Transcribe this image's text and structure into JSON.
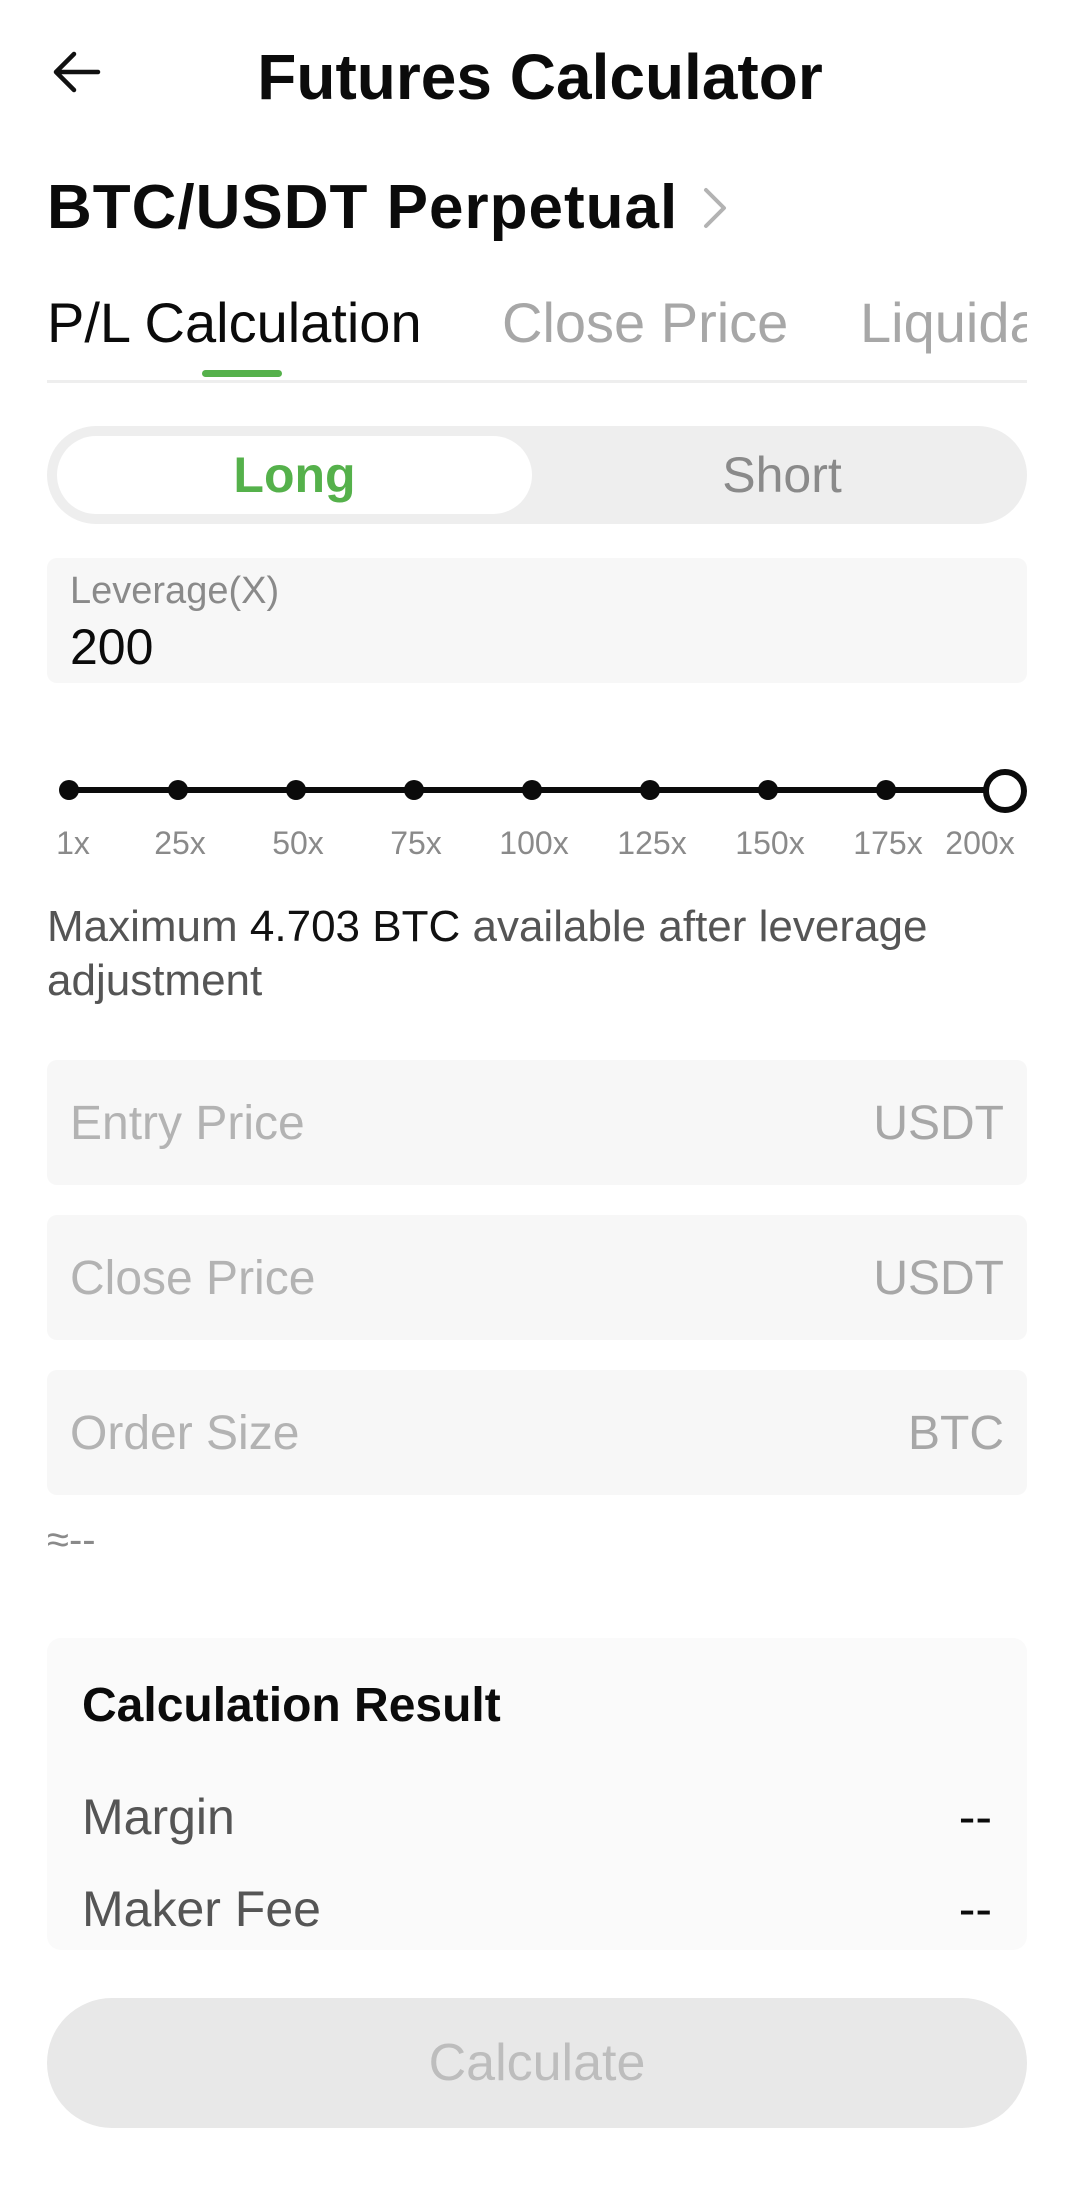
{
  "header": {
    "title": "Futures Calculator",
    "back_icon": "arrow-left-icon"
  },
  "pair": {
    "name": "BTC/USDT Perpetual",
    "chevron_icon": "chevron-right-icon"
  },
  "tabs": [
    {
      "label": "P/L Calculation",
      "active": true
    },
    {
      "label": "Close Price",
      "active": false
    },
    {
      "label": "Liquidati",
      "active": false
    }
  ],
  "direction": {
    "long_label": "Long",
    "short_label": "Short",
    "selected": "Long"
  },
  "leverage": {
    "label": "Leverage(X)",
    "value": "200",
    "slider_labels": [
      "1x",
      "25x",
      "50x",
      "75x",
      "100x",
      "125x",
      "150x",
      "175x",
      "200x"
    ],
    "slider_level": 1.0
  },
  "max_info": {
    "prefix": "Maximum ",
    "amount": "4.703 BTC",
    "suffix": " available after leverage adjustment"
  },
  "inputs": {
    "entry_price": {
      "placeholder": "Entry Price",
      "unit": "USDT"
    },
    "close_price": {
      "placeholder": "Close Price",
      "unit": "USDT"
    },
    "order_size": {
      "placeholder": "Order Size",
      "unit": "BTC"
    },
    "approx": "≈--"
  },
  "result": {
    "title": "Calculation Result",
    "rows": [
      {
        "label": "Margin",
        "value": "--"
      },
      {
        "label": "Maker Fee",
        "value": "--"
      }
    ]
  },
  "calculate_label": "Calculate",
  "colors": {
    "accent": "#55b14b",
    "text_primary": "#0b0b0b",
    "text_muted": "#a7a7a7",
    "field_bg": "#f7f7f7"
  }
}
